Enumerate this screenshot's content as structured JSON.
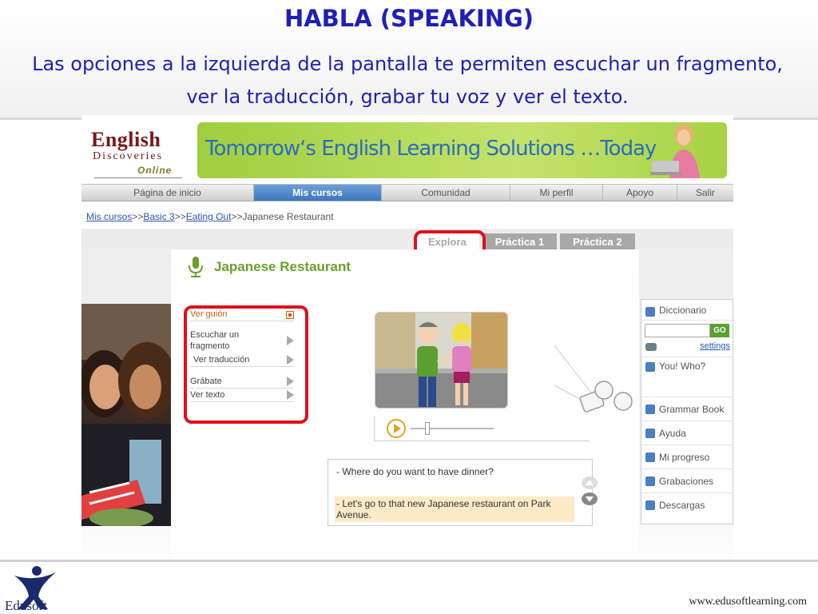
{
  "slide": {
    "title": "HABLA (SPEAKING)",
    "subtitle": "Las opciones a la izquierda de la pantalla te permiten escuchar un fragmento, ver la traducción, grabar tu voz y ver el texto.",
    "footer_logo_text": "Edusoft",
    "footer_url": "www.edusoftlearning.com"
  },
  "app": {
    "logo": {
      "line1": "English",
      "line2": "Discoveries",
      "line3": "Online"
    },
    "banner_text": "Tomorrow‘s English Learning Solutions …Today",
    "nav": [
      {
        "label": "Página de inicio"
      },
      {
        "label": "Mis cursos"
      },
      {
        "label": "Comunidad"
      },
      {
        "label": "Mi perfil"
      },
      {
        "label": "Apoyo"
      },
      {
        "label": "Salir"
      }
    ],
    "breadcrumb": {
      "link1": "Mis cursos",
      "sep": ">>",
      "link2": "Basic 3",
      "link3": "Eating Out",
      "current": "Japanese Restaurant"
    },
    "tabs": [
      {
        "label": "Explora"
      },
      {
        "label": "Práctica 1"
      },
      {
        "label": "Práctica 2"
      }
    ],
    "lesson_title": "Japanese Restaurant",
    "menu": [
      {
        "label": "Ver guión"
      },
      {
        "label": "Escuchar un fragmento"
      },
      {
        "label": "Ver traducción"
      },
      {
        "label": "Grábate"
      },
      {
        "label": "Ver texto"
      }
    ],
    "transcript": {
      "line1": "- Where do you want to have dinner?",
      "line2": "- Let's go to that new Japanese restaurant on Park Avenue."
    },
    "sidebar": {
      "dictionary_label": "Diccionario",
      "dictionary_input": "",
      "go_label": "GO",
      "settings_label": "settings",
      "items": [
        {
          "label": "You! Who?"
        },
        {
          "label": "Grammar Book"
        },
        {
          "label": "Ayuda"
        },
        {
          "label": "Mi progreso"
        },
        {
          "label": "Grabaciones"
        },
        {
          "label": "Descargas"
        }
      ]
    },
    "colors": {
      "accent_blue": "#3d77bf",
      "title_green": "#6aa02c",
      "highlight_red": "#e0101a",
      "slide_blue": "#1f1fb8"
    }
  }
}
